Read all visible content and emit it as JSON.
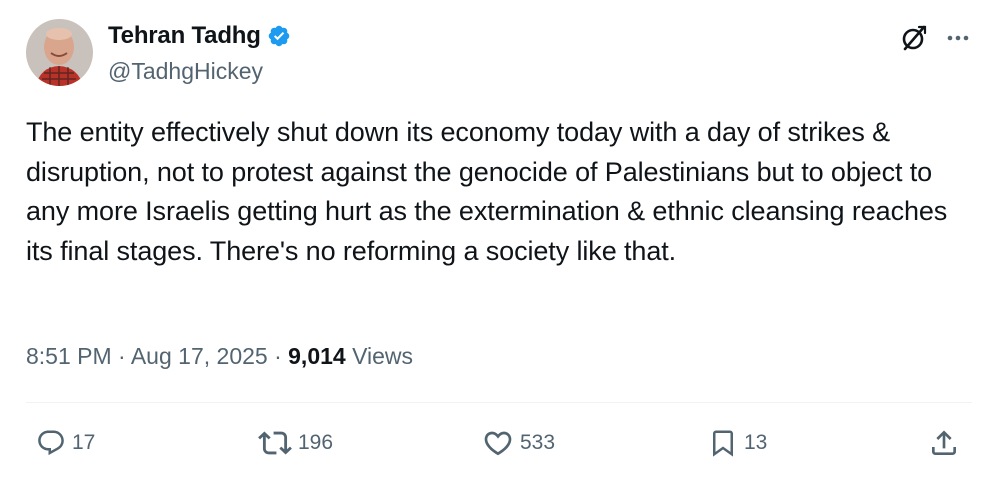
{
  "author": {
    "name": "Tehran Tadhg",
    "handle": "@TadhgHickey",
    "verified": true
  },
  "tweet": {
    "text": "The entity effectively shut down its economy today with a day of strikes & disruption, not to protest against the genocide of Palestinians but to object to any more Israelis getting hurt as the extermination & ethnic cleansing reaches its final stages. There's no reforming a society like that."
  },
  "meta": {
    "time": "8:51 PM",
    "separator": "·",
    "date": "Aug 17, 2025",
    "views_count": "9,014",
    "views_label": "Views"
  },
  "actions": {
    "replies": "17",
    "reposts": "196",
    "likes": "533",
    "bookmarks": "13"
  },
  "icons": {
    "verified": "verified-badge-icon",
    "grok": "grok-icon",
    "more": "more-icon",
    "reply": "reply-icon",
    "repost": "repost-icon",
    "like": "heart-icon",
    "bookmark": "bookmark-icon",
    "share": "share-icon"
  },
  "colors": {
    "text": "#0f1419",
    "secondary": "#536471",
    "verified": "#1d9bf0",
    "divider": "#eff3f4"
  }
}
